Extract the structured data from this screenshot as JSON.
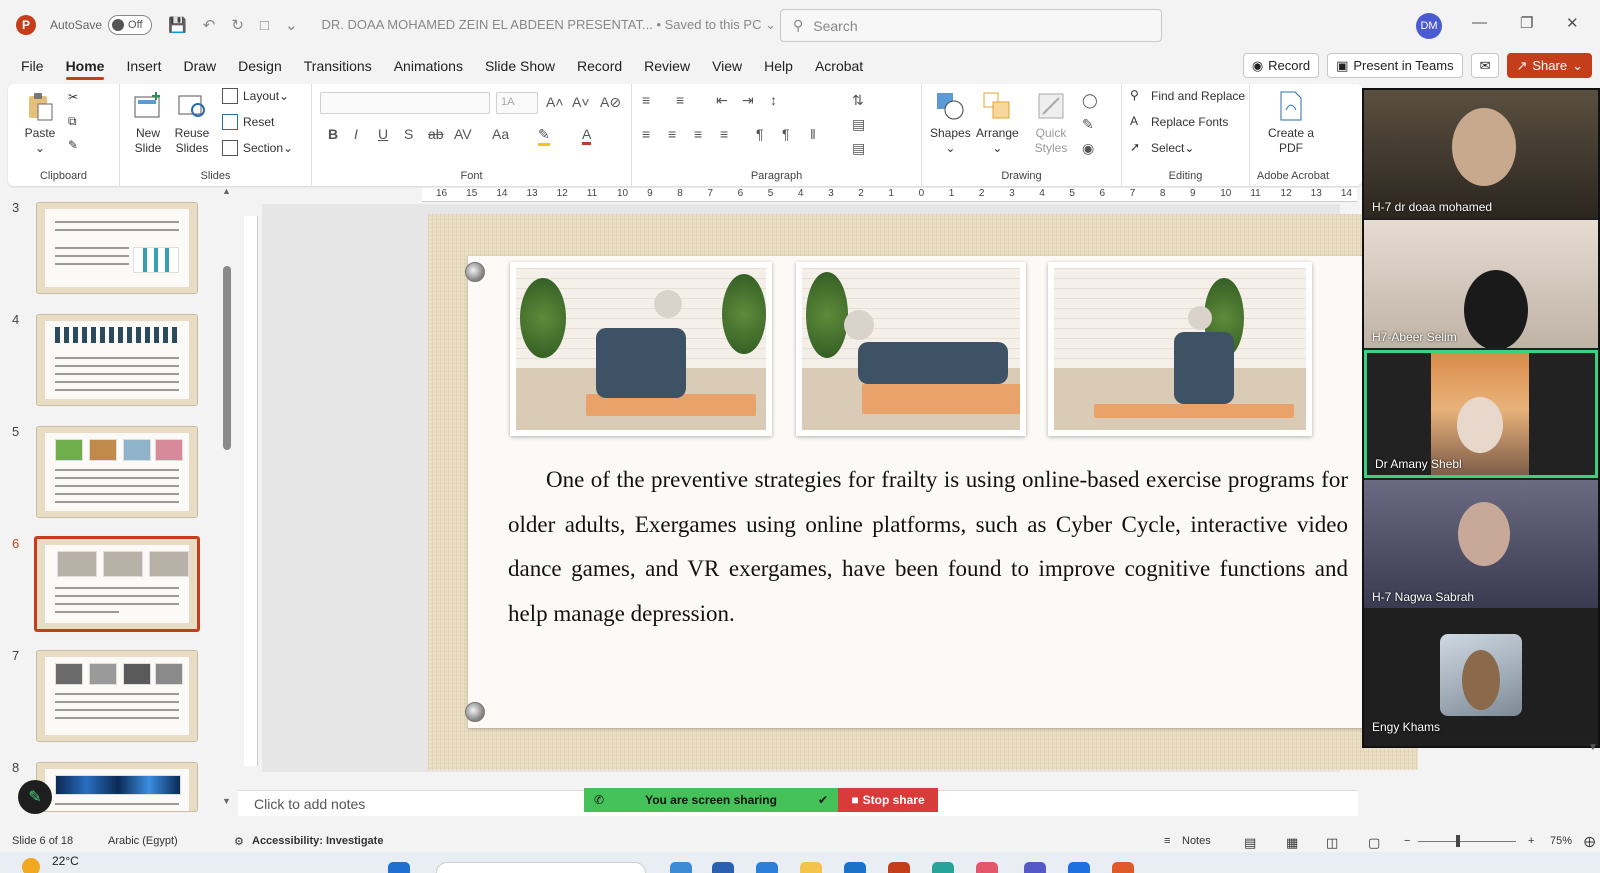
{
  "titlebar": {
    "app_icon_letter": "P",
    "autosave_label": "AutoSave",
    "autosave_state": "Off",
    "document_title": "DR. DOAA MOHAMED ZEIN EL ABDEEN PRESENTAT... • Saved to this PC ⌄",
    "search_placeholder": "Search",
    "user_initials": "DM"
  },
  "menu": {
    "tabs": [
      "File",
      "Home",
      "Insert",
      "Draw",
      "Design",
      "Transitions",
      "Animations",
      "Slide Show",
      "Record",
      "Review",
      "View",
      "Help",
      "Acrobat"
    ],
    "active_tab": "Home",
    "record_label": "Record",
    "present_teams_label": "Present in Teams",
    "share_label": "Share"
  },
  "ribbon": {
    "clipboard": {
      "paste": "Paste",
      "label": "Clipboard"
    },
    "slides": {
      "new_slide": "New Slide",
      "reuse_slides": "Reuse Slides",
      "layout": "Layout",
      "reset": "Reset",
      "section": "Section",
      "label": "Slides"
    },
    "font": {
      "label": "Font",
      "size_placeholder": "1A"
    },
    "paragraph": {
      "label": "Paragraph"
    },
    "drawing": {
      "shapes": "Shapes",
      "arrange": "Arrange",
      "quick_styles": "Quick Styles",
      "label": "Drawing"
    },
    "editing": {
      "find_replace": "Find and Replace",
      "replace_fonts": "Replace Fonts",
      "select": "Select",
      "label": "Editing"
    },
    "acrobat": {
      "create_pdf": "Create a PDF",
      "label": "Adobe Acrobat"
    }
  },
  "ruler": {
    "ticks": [
      "16",
      "15",
      "14",
      "13",
      "12",
      "11",
      "10",
      "9",
      "8",
      "7",
      "6",
      "5",
      "4",
      "3",
      "2",
      "1",
      "0",
      "1",
      "2",
      "3",
      "4",
      "5",
      "6",
      "7",
      "8",
      "9",
      "10",
      "11",
      "12",
      "13",
      "14"
    ]
  },
  "thumbnails": [
    {
      "number": "3",
      "active": false
    },
    {
      "number": "4",
      "active": false
    },
    {
      "number": "5",
      "active": false
    },
    {
      "number": "6",
      "active": true
    },
    {
      "number": "7",
      "active": false
    },
    {
      "number": "8",
      "active": false
    }
  ],
  "slide": {
    "body_text": "One of the preventive strategies for frailty is using online-based exercise programs for older adults, Exergames using online platforms, such as Cyber Cycle, interactive video dance games, and VR exergames, have been found to improve cognitive functions and help manage depression."
  },
  "notes": {
    "placeholder": "Click to add notes"
  },
  "screen_share": {
    "status": "You are screen sharing",
    "stop": "Stop share"
  },
  "participants": [
    {
      "name": "H-7 dr doaa mohamed"
    },
    {
      "name": "H7-Abeer Selim"
    },
    {
      "name": "Dr Amany Shebl",
      "active_speaker": true
    },
    {
      "name": "H-7 Nagwa Sabrah"
    },
    {
      "name": "Engy Khams"
    }
  ],
  "statusbar": {
    "slide_count": "Slide 6 of 18",
    "language": "Arabic (Egypt)",
    "accessibility": "Accessibility: Investigate",
    "notes_label": "Notes",
    "zoom": "75%"
  },
  "taskbar": {
    "weather": "22°C"
  }
}
